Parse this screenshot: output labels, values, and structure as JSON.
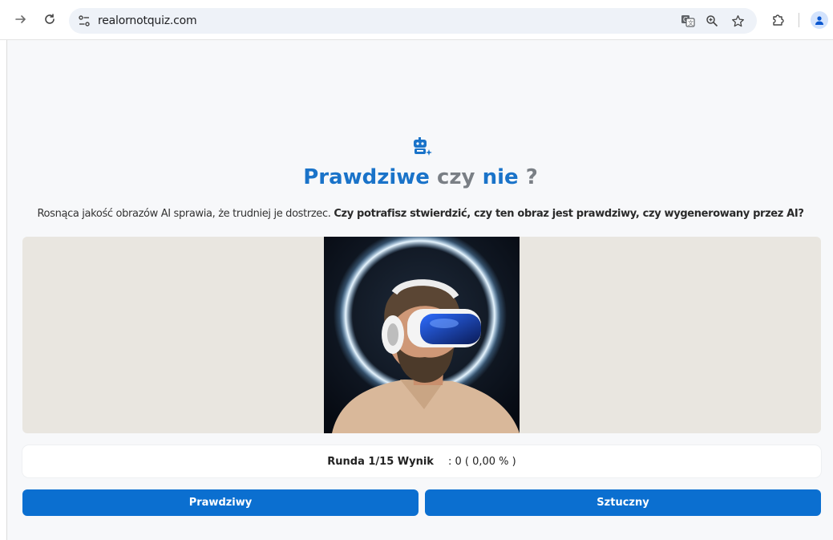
{
  "browser": {
    "url": "realornotquiz.com",
    "icons": {
      "back": "arrow-right-icon",
      "reload": "reload-icon",
      "site_info": "site-settings-icon",
      "translate": "translate-icon",
      "zoom": "zoom-icon",
      "bookmark": "star-icon",
      "extensions": "puzzle-icon",
      "profile": "profile-icon"
    }
  },
  "quiz": {
    "logo_icon": "robot-icon",
    "title_word1": "Prawdziwe",
    "title_word2": "czy",
    "title_word3": "nie",
    "title_word4": "?",
    "intro_text": "Rosnąca jakość obrazów AI sprawia, że trudniej je dostrzec.",
    "intro_question": "Czy potrafisz stwierdzić, czy ten obraz jest prawdziwy, czy wygenerowany przez AI?",
    "round_label": "Runda 1/15 Wynik",
    "score_value": ": 0 ( 0,00 % )",
    "button_real": "Prawdziwy",
    "button_fake": "Sztuczny"
  },
  "colors": {
    "accent": "#0b6fd0",
    "title_blue": "#1a73c9",
    "title_gray": "#7a7f85",
    "image_frame_bg": "#e9e6e0"
  }
}
